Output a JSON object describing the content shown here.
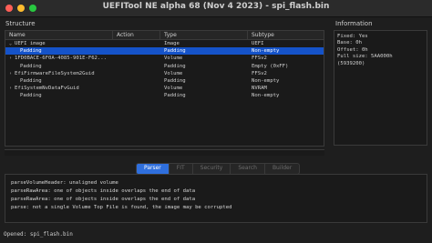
{
  "window": {
    "title": "UEFITool NE alpha 68 (Nov  4 2023) - spi_flash.bin"
  },
  "structure": {
    "label": "Structure",
    "columns": [
      "Name",
      "Action",
      "Type",
      "Subtype"
    ],
    "rows": [
      {
        "arrow": "⌄",
        "name": "UEFI image",
        "action": "",
        "type": "Image",
        "subtype": "UEFI",
        "selected": false
      },
      {
        "arrow": "",
        "name": "Padding",
        "action": "",
        "type": "Padding",
        "subtype": "Non-empty",
        "selected": true
      },
      {
        "arrow": "›",
        "name": "1FD0BACE-6F0A-4085-901E-F62...",
        "action": "",
        "type": "Volume",
        "subtype": "FFSv2",
        "selected": false
      },
      {
        "arrow": "",
        "name": "Padding",
        "action": "",
        "type": "Padding",
        "subtype": "Empty (0xFF)",
        "selected": false
      },
      {
        "arrow": "›",
        "name": "EfiFirmwareFileSystem2Guid",
        "action": "",
        "type": "Volume",
        "subtype": "FFSv2",
        "selected": false
      },
      {
        "arrow": "",
        "name": "Padding",
        "action": "",
        "type": "Padding",
        "subtype": "Non-empty",
        "selected": false
      },
      {
        "arrow": "›",
        "name": "EfiSystemNvDataFvGuid",
        "action": "",
        "type": "Volume",
        "subtype": "NVRAM",
        "selected": false
      },
      {
        "arrow": "",
        "name": "Padding",
        "action": "",
        "type": "Padding",
        "subtype": "Non-empty",
        "selected": false
      }
    ]
  },
  "information": {
    "label": "Information",
    "lines": [
      "Fixed: Yes",
      "Base: 0h",
      "Offset: 0h",
      "Full size: 5AA000h",
      "(5939200)"
    ]
  },
  "tabs": [
    {
      "label": "Parser",
      "active": true
    },
    {
      "label": "FIT",
      "active": false
    },
    {
      "label": "Security",
      "active": false
    },
    {
      "label": "Search",
      "active": false
    },
    {
      "label": "Builder",
      "active": false
    }
  ],
  "log": {
    "lines": [
      "parseVolumeHeader: unaligned volume",
      "parseRawArea: one of objects inside overlaps the end of data",
      "parseRawArea: one of objects inside overlaps the end of data",
      "parse: not a single Volume Top File is found, the image may be corrupted"
    ]
  },
  "status": {
    "text": "Opened: spi_flash.bin"
  },
  "colors": {
    "selection": "#1553c9",
    "active_tab": "#2f6fdd",
    "background": "#1e1e1e"
  }
}
